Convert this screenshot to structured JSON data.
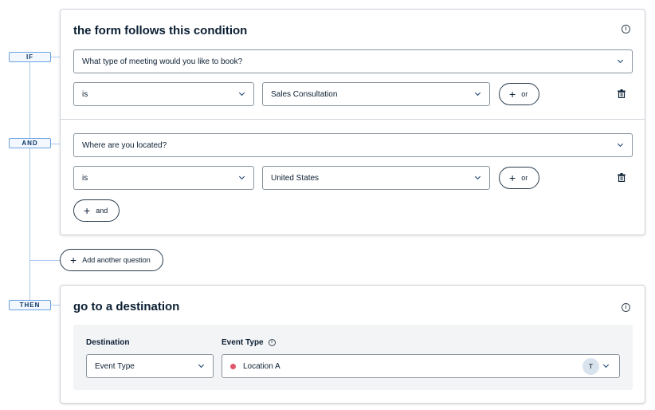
{
  "labels": {
    "if": "IF",
    "and": "AND",
    "then": "THEN"
  },
  "condition_card": {
    "title": "the form follows this condition",
    "rules": [
      {
        "question": "What type of meeting would you like to book?",
        "operator": "is",
        "value": "Sales Consultation",
        "or_label": "or"
      },
      {
        "question": "Where are you located?",
        "operator": "is",
        "value": "United States",
        "or_label": "or"
      }
    ],
    "and_label": "and"
  },
  "add_question_label": "Add another question",
  "destination_card": {
    "title": "go to a destination",
    "destination_label": "Destination",
    "destination_value": "Event Type",
    "event_type_label": "Event Type",
    "event_type_value": "Location A",
    "avatar_initial": "T"
  },
  "colors": {
    "accent": "#006bff",
    "connector": "#a9c9ee",
    "location_dot": "#e0566a"
  },
  "icons": [
    "info-icon",
    "chevron-down-icon",
    "plus-icon",
    "trash-icon"
  ]
}
